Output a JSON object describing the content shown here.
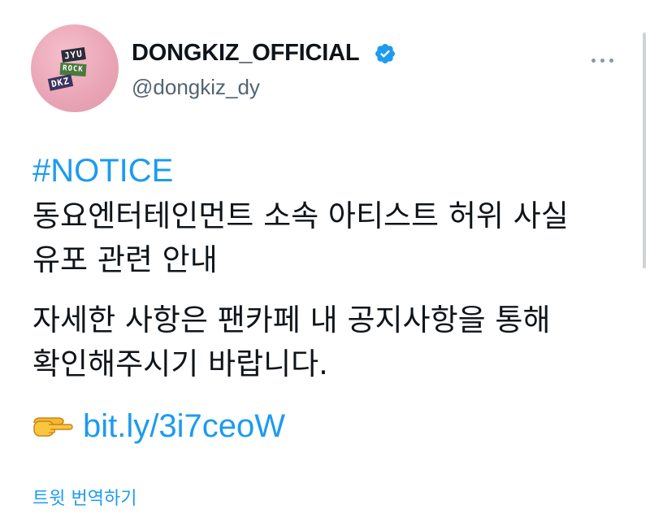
{
  "account": {
    "display_name": "DONGKIZ_OFFICIAL",
    "handle": "@dongkiz_dy"
  },
  "tweet": {
    "hashtag": "#NOTICE",
    "lines": [
      "동요엔터테인먼트 소속 아티스트 허위 사실",
      "유포 관련 안내",
      "자세한 사항은 팬카페 내 공지사항을 통해",
      "확인해주시기 바랍니다."
    ],
    "link_text": "bit.ly/3i7ceoW",
    "link_icon": "backhand-index-pointing-right-icon"
  },
  "actions": {
    "translate_label": "트윗 번역하기",
    "more_icon": "more-options-icon"
  },
  "colors": {
    "link_blue": "#1d9bf0",
    "text_primary": "#0f1419",
    "text_secondary": "#536471",
    "avatar_pink": "#eaa6b6"
  }
}
